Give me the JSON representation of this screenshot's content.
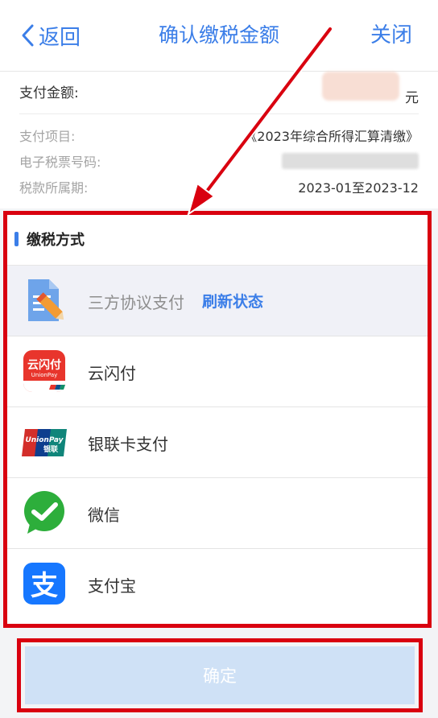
{
  "nav": {
    "back_label": "返回",
    "title": "确认缴税金额",
    "close_label": "关闭"
  },
  "summary": {
    "amount_label": "支付金额:",
    "amount_unit": "元",
    "rows": [
      {
        "label": "支付项目:",
        "value": "《2023年综合所得汇算清缴》"
      },
      {
        "label": "电子税票号码:",
        "value": ""
      },
      {
        "label": "税款所属期:",
        "value": "2023-01至2023-12"
      }
    ]
  },
  "payment": {
    "section_title": "缴税方式",
    "options": [
      {
        "label": "三方协议支付",
        "action": "刷新状态",
        "icon": "agreement-document-pen-icon",
        "enabled": false
      },
      {
        "label": "云闪付",
        "icon": "unionpay-quickpass-icon",
        "enabled": true
      },
      {
        "label": "银联卡支付",
        "icon": "unionpay-card-icon",
        "enabled": true
      },
      {
        "label": "微信",
        "icon": "wechat-pay-icon",
        "enabled": true
      },
      {
        "label": "支付宝",
        "icon": "alipay-icon",
        "enabled": true
      }
    ]
  },
  "confirm_label": "确定",
  "icon_texts": {
    "yunshanfu_cn": "云闪付",
    "yunshanfu_en": "UnionPay",
    "unionpay_en": "UnionPay",
    "unionpay_cn": "银联",
    "alipay_char": "支"
  },
  "colors": {
    "accent": "#3b7ee8",
    "highlight_red": "#d9000f",
    "confirm_bg": "#cfe1f6",
    "wechat_green": "#2dae3b",
    "alipay_blue": "#1677ff"
  }
}
